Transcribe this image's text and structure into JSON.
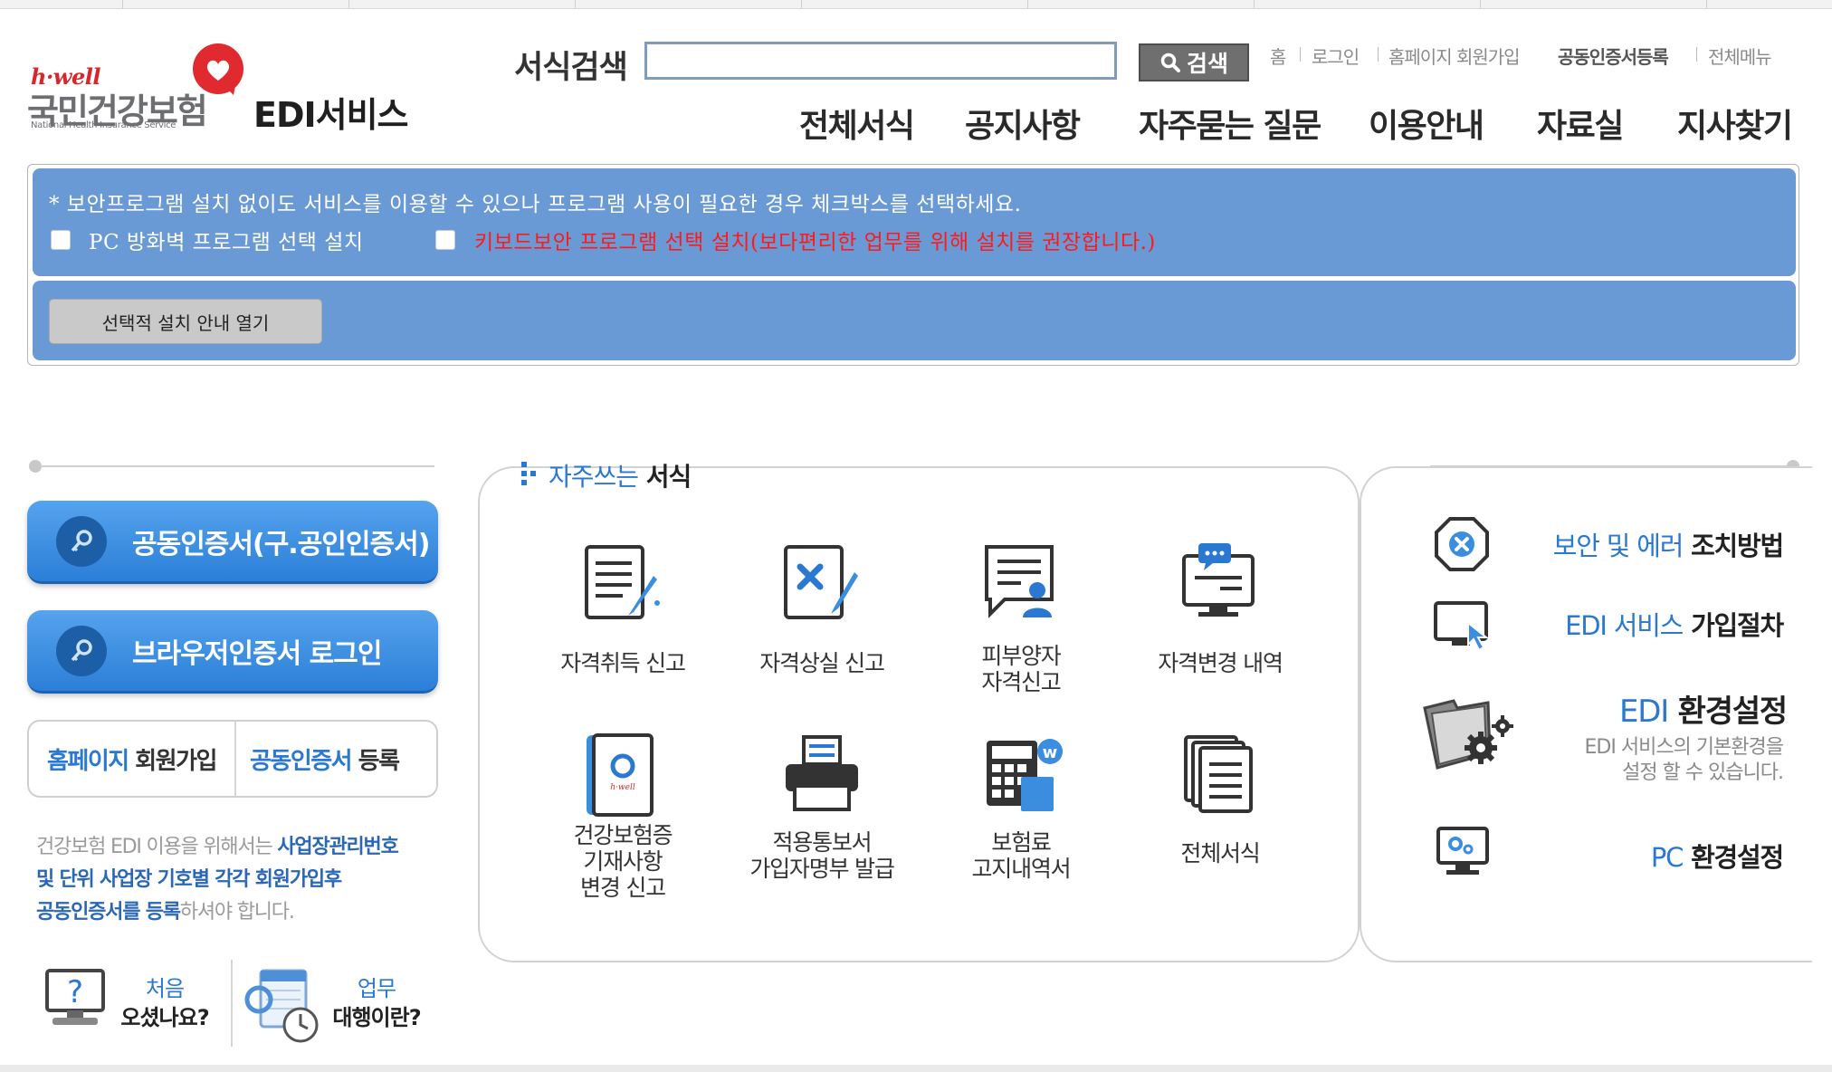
{
  "logo": {
    "brand": "h·well",
    "name": "국민건강보험",
    "english": "National Health Insurance Service",
    "service": "EDI서비스"
  },
  "search": {
    "label": "서식검색",
    "value": "",
    "button": "검색"
  },
  "util_links": [
    "홈",
    "로그인",
    "홈페이지 회원가입",
    "공동인증서등록",
    "전체메뉴"
  ],
  "nav": [
    "전체서식",
    "공지사항",
    "자주묻는 질문",
    "이용안내",
    "자료실",
    "지사찾기"
  ],
  "security": {
    "notice": "* 보안프로그램 설치 없이도 서비스를 이용할 수 있으나 프로그램 사용이 필요한 경우 체크박스를 선택하세요.",
    "firewall_label": "PC 방화벽 프로그램 선택 설치",
    "keyboard_label": "키보드보안 프로그램 선택 설치(보다편리한 업무를 위해 설치를 권장합니다.)",
    "guide_button": "선택적 설치 안내 열기"
  },
  "left": {
    "cert_login": "공동인증서(구.공인인증서)",
    "browser_login": "브라우저인증서 로그인",
    "join_blue": "홈페이지",
    "join_rest": "회원가입",
    "register_blue": "공동인증서",
    "register_rest": "등록",
    "info_1": "건강보험 EDI 이용을 위해서는",
    "info_2": "사업장관리번호",
    "info_3": "및 단위 사업장 기호별 각각 회원가입후",
    "info_4": "공동인증서를 등록",
    "info_5": "하셔야 합니다.",
    "first_blue": "처음",
    "first_rest": "오셨나요?",
    "agent_blue": "업무",
    "agent_rest": "대행이란?"
  },
  "frequent": {
    "title_blue": "자주쓰는",
    "title_rest": "서식",
    "items": [
      {
        "label": "자격취득 신고",
        "icon": "document-pen-icon"
      },
      {
        "label": "자격상실 신고",
        "icon": "document-x-icon"
      },
      {
        "label": "피부양자\n자격신고",
        "icon": "chat-person-icon"
      },
      {
        "label": "자격변경 내역",
        "icon": "monitor-chat-icon"
      },
      {
        "label": "건강보험증\n기재사항\n변경 신고",
        "icon": "insurance-card-icon"
      },
      {
        "label": "적용통보서\n가입자명부 발급",
        "icon": "printer-icon"
      },
      {
        "label": "보험료\n고지내역서",
        "icon": "calculator-icon"
      },
      {
        "label": "전체서식",
        "icon": "stacked-documents-icon"
      }
    ]
  },
  "right": {
    "security_blue": "보안 및 에러",
    "security_rest": "조치방법",
    "join_blue": "EDI 서비스",
    "join_rest": "가입절차",
    "env_blue": "EDI",
    "env_rest": "환경설정",
    "env_sub_1": "EDI 서비스의 기본환경을",
    "env_sub_2": "설정 할 수 있습니다.",
    "pc_blue": "PC",
    "pc_rest": "환경설정"
  },
  "colors": {
    "panel_blue": "#6a9ad6",
    "button_blue": "#2b7fd7",
    "link_blue": "#2a78d0",
    "warning_red": "#ff1a1a",
    "brand_red": "#d9262b"
  }
}
